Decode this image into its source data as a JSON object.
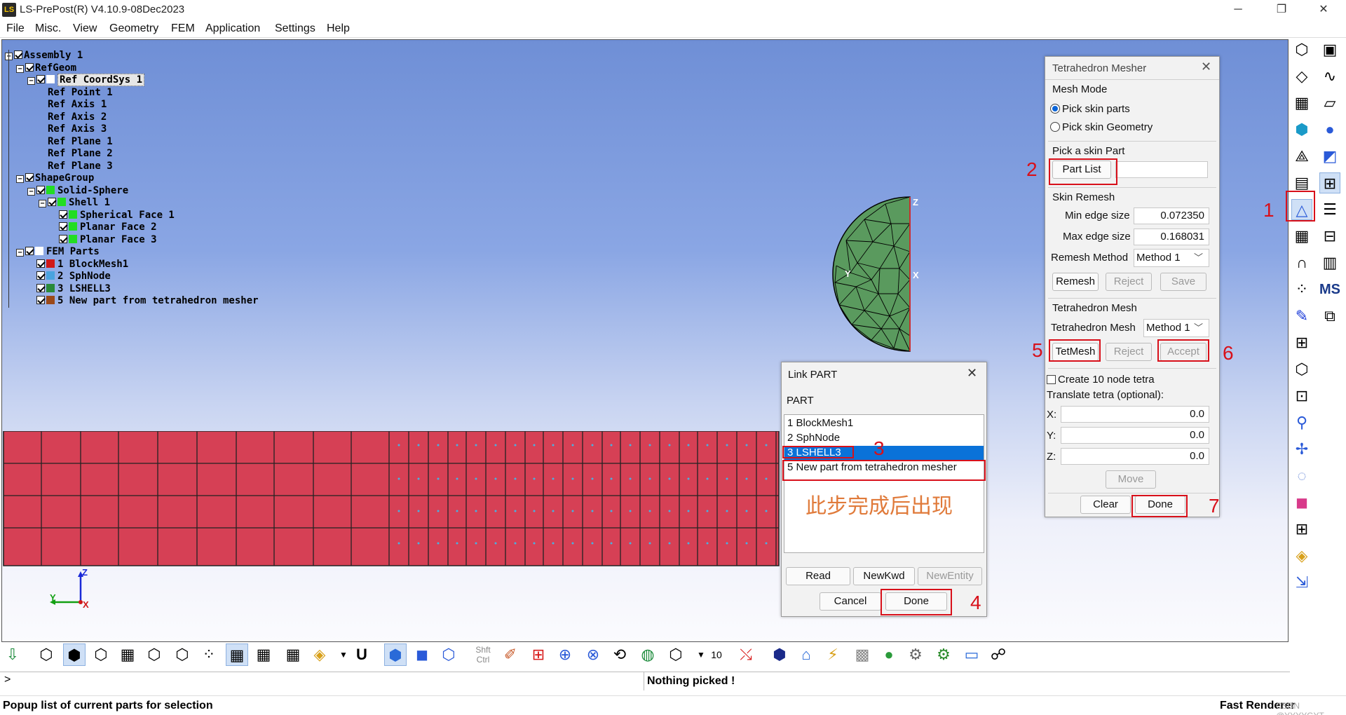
{
  "window": {
    "title": "LS-PrePost(R) V4.10.9-08Dec2023",
    "app_icon": "LS",
    "controls": [
      "─",
      "❐",
      "✕"
    ]
  },
  "menu": [
    "File",
    "Misc.",
    "View",
    "Geometry",
    "FEM",
    "Application",
    "Settings",
    "Help"
  ],
  "tree": [
    {
      "label": "Assembly 1",
      "level": 0,
      "expander": "−",
      "checked": true
    },
    {
      "label": "RefGeom",
      "level": 1,
      "expander": "−",
      "checked": true
    },
    {
      "label": "Ref CoordSys 1",
      "level": 2,
      "expander": "−",
      "checked": true,
      "selected": true,
      "swatch": "#ffffff"
    },
    {
      "label": "Ref Point 1",
      "level": 3
    },
    {
      "label": "Ref Axis 1",
      "level": 3
    },
    {
      "label": "Ref Axis 2",
      "level": 3
    },
    {
      "label": "Ref Axis 3",
      "level": 3
    },
    {
      "label": "Ref Plane 1",
      "level": 3
    },
    {
      "label": "Ref Plane 2",
      "level": 3
    },
    {
      "label": "Ref Plane 3",
      "level": 3
    },
    {
      "label": "ShapeGroup",
      "level": 1,
      "expander": "−",
      "checked": true
    },
    {
      "label": "Solid-Sphere",
      "level": 2,
      "expander": "−",
      "checked": true,
      "swatch": "#22dd22"
    },
    {
      "label": "Shell 1",
      "level": 3,
      "expander": "−",
      "checked": true,
      "swatch": "#22dd22"
    },
    {
      "label": "Spherical Face 1",
      "level": 4,
      "checked": true,
      "swatch": "#22dd22"
    },
    {
      "label": "Planar Face 2",
      "level": 4,
      "checked": true,
      "swatch": "#22dd22"
    },
    {
      "label": "Planar Face 3",
      "level": 4,
      "checked": true,
      "swatch": "#22dd22"
    },
    {
      "label": "FEM Parts",
      "level": 1,
      "expander": "−",
      "checked": true,
      "swatch": "#ffffff"
    },
    {
      "label": "1 BlockMesh1",
      "level": 2,
      "checked": true,
      "swatch": "#d01818"
    },
    {
      "label": "2 SphNode",
      "level": 2,
      "checked": true,
      "swatch": "#4aa3df"
    },
    {
      "label": "3 LSHELL3",
      "level": 2,
      "checked": true,
      "swatch": "#2a8a3a"
    },
    {
      "label": "5 New part from tetrahedron mesher",
      "level": 2,
      "checked": true,
      "swatch": "#9b4a1a"
    }
  ],
  "viewport": {
    "triad_labels": {
      "z": "Z",
      "y": "Y",
      "x": "X"
    },
    "sphere_labels": {
      "z": "Z",
      "x": "X",
      "y": "Y"
    },
    "block_color": "#d64055",
    "sphere_color": "#5a9a5e"
  },
  "tet_mesher": {
    "title": "Tetrahedron Mesher",
    "mesh_mode_label": "Mesh Mode",
    "radio_skin_parts": "Pick skin parts",
    "radio_skin_geometry": "Pick skin Geometry",
    "pick_skin_part_label": "Pick a skin Part",
    "part_list_button": "Part List",
    "skin_remesh_label": "Skin Remesh",
    "min_edge_label": "Min edge size",
    "min_edge_value": "0.072350",
    "max_edge_label": "Max edge size",
    "max_edge_value": "0.168031",
    "remesh_method_label": "Remesh Method",
    "remesh_method_value": "Method 1",
    "remesh_button": "Remesh",
    "reject_button": "Reject",
    "save_button": "Save",
    "tet_mesh_section": "Tetrahedron Mesh",
    "tet_mesh_label": "Tetrahedron Mesh",
    "tet_mesh_value": "Method 1",
    "tetmesh_button": "TetMesh",
    "reject2_button": "Reject",
    "accept_button": "Accept",
    "create_10node_label": "Create 10 node tetra",
    "translate_label": "Translate tetra (optional):",
    "x_label": "X:",
    "x_value": "0.0",
    "y_label": "Y:",
    "y_value": "0.0",
    "z_label": "Z:",
    "z_value": "0.0",
    "move_button": "Move",
    "clear_button": "Clear",
    "done_button": "Done"
  },
  "link_part": {
    "title": "Link PART",
    "part_label": "PART",
    "items": [
      "1  BlockMesh1",
      "2  SphNode",
      "3  LSHELL3",
      "5  New part from tetrahedron mesher"
    ],
    "annotation": "此步完成后出现",
    "read_button": "Read",
    "newkwd_button": "NewKwd",
    "newentity_button": "NewEntity",
    "cancel_button": "Cancel",
    "done_button": "Done"
  },
  "annotations": [
    "1",
    "2",
    "3",
    "4",
    "5",
    "6",
    "7"
  ],
  "bottom_toolbar": {
    "num_label": "10",
    "shft_label": "Shft",
    "ctrl_label": "Ctrl",
    "u_label": "U"
  },
  "right_toolbar": {
    "ms_label": "MS"
  },
  "command_line": {
    "prompt": ">",
    "message": "Nothing picked !"
  },
  "status": {
    "left": "Popup list of current parts for selection",
    "right": "Fast Renderer",
    "watermark": "CSDN @YYYYGYT"
  }
}
